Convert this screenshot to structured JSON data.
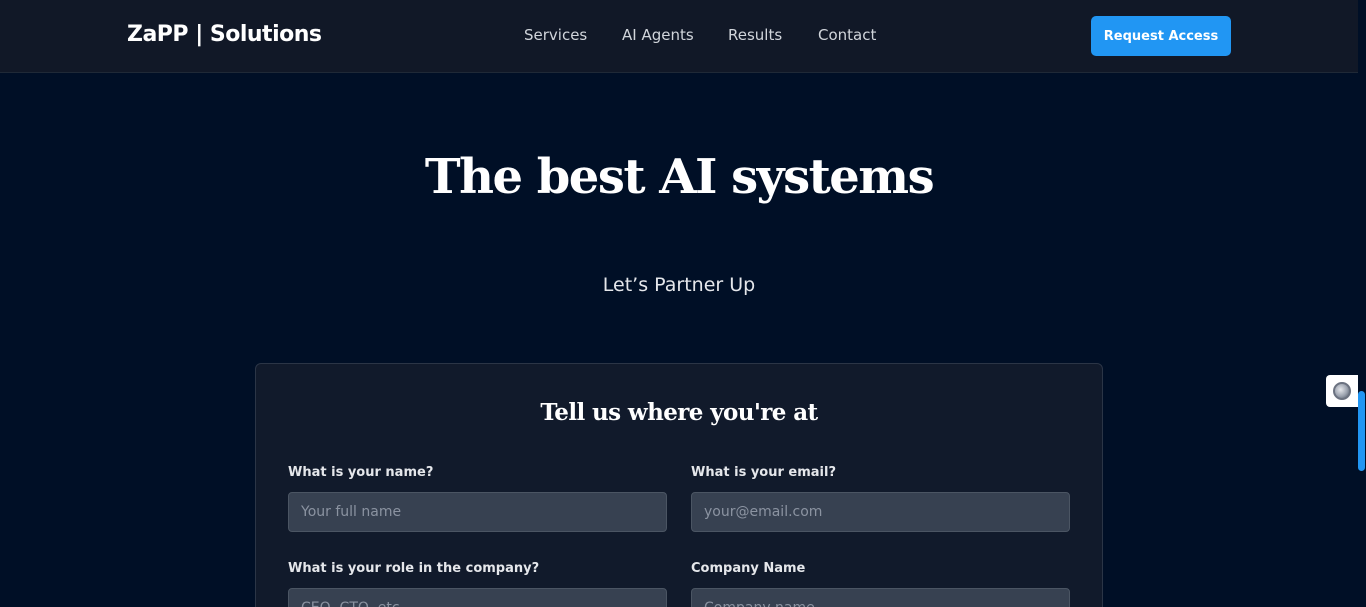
{
  "header": {
    "brand": "ZaPP | Solutions",
    "nav": [
      "Services",
      "AI Agents",
      "Results",
      "Contact"
    ],
    "cta_label": "Request Access"
  },
  "hero": {
    "title": "The best AI systems",
    "subtitle": "Let’s Partner Up"
  },
  "form": {
    "title": "Tell us where you're at",
    "fields": [
      {
        "label": "What is your name?",
        "placeholder": "Your full name",
        "value": ""
      },
      {
        "label": "What is your email?",
        "placeholder": "your@email.com",
        "value": ""
      },
      {
        "label": "What is your role in the company?",
        "placeholder": "CEO, CTO, etc.",
        "value": ""
      },
      {
        "label": "Company Name",
        "placeholder": "Company name",
        "value": ""
      }
    ]
  },
  "colors": {
    "page_bg": "#000f26",
    "navbar_bg": "#111827",
    "accent": "#2196f3",
    "card_bg": "#111a2b",
    "input_bg": "#374151"
  },
  "widget": {
    "icon": "chat-widget-icon"
  }
}
